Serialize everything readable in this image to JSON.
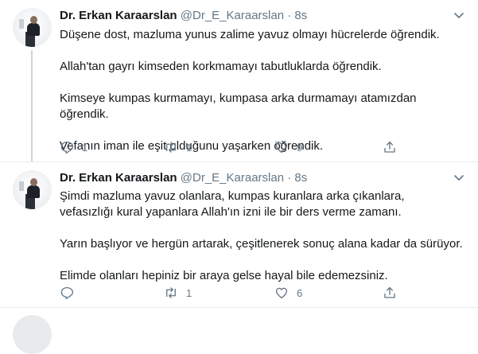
{
  "tweets": [
    {
      "name": "Dr. Erkan Karaarslan",
      "handle": "@Dr_E_Karaarslan",
      "separator": "·",
      "time": "8s",
      "paragraphs": [
        "Düşene dost, mazluma yunus zalime yavuz olmayı hücrelerde öğrendik.",
        "Allah'tan gayrı kimseden korkmamayı tabutluklarda öğrendik.",
        "Kimseye kumpas kurmamayı, kumpasa arka durmamayı atamızdan öğrendik.",
        "Vefanın iman ile eşit olduğunu yaşarken öğrendik."
      ],
      "actions": {
        "reply": "1",
        "retweet": "1",
        "like": "9"
      }
    },
    {
      "name": "Dr. Erkan Karaarslan",
      "handle": "@Dr_E_Karaarslan",
      "separator": "·",
      "time": "8s",
      "paragraphs": [
        "Şimdi mazluma yavuz olanlara, kumpas kuranlara arka çıkanlara, vefasızlığı kural yapanlara Allah'ın izni ile bir ders verme zamanı.",
        "Yarın başlıyor ve hergün artarak, çeşitlenerek sonuç alana kadar da sürüyor.",
        "Elimde olanları hepiniz bir araya gelse hayal bile edemezsiniz."
      ],
      "actions": {
        "reply": "",
        "retweet": "1",
        "like": "6"
      }
    }
  ],
  "icons": {
    "reply": "reply-icon",
    "retweet": "retweet-icon",
    "like": "like-icon",
    "share": "share-icon",
    "caret": "chevron-down-icon"
  },
  "colors": {
    "text": "#14171a",
    "secondary": "#657786",
    "thread_line": "#ccd6dd",
    "divider": "#e6ecf0"
  }
}
